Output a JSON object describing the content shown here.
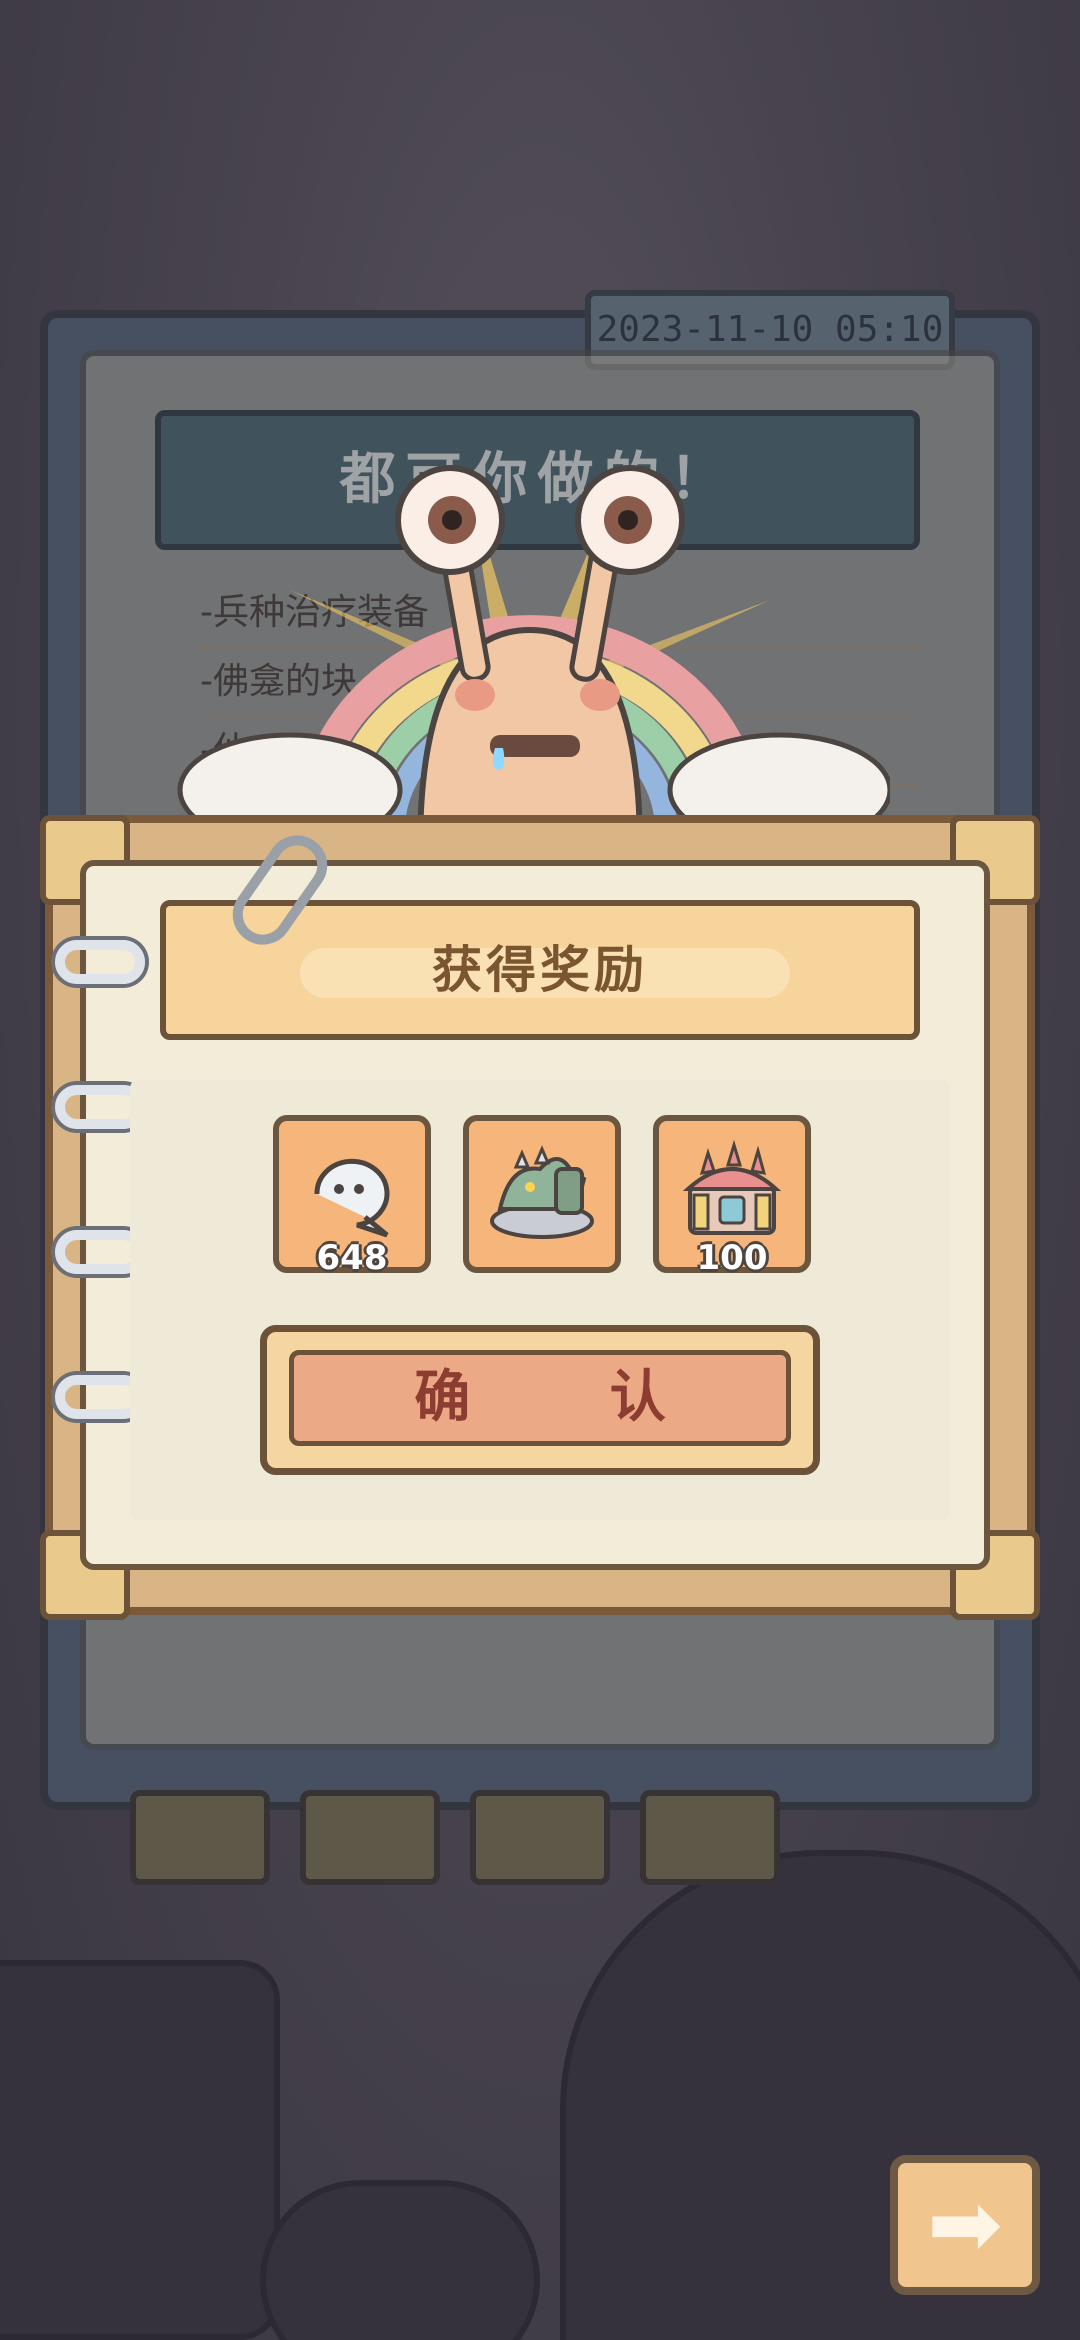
{
  "background": {
    "date_stamp": "2023-11-10 05:10",
    "header_text": "都可你做的！",
    "list_lines": [
      "-兵种治疗装备",
      "-佛龛的块",
      "-伙"
    ]
  },
  "dialog": {
    "title": "获得奖励",
    "rewards": [
      {
        "icon": "ghost-bubble-icon",
        "count": "648"
      },
      {
        "icon": "dragon-tank-icon",
        "count": ""
      },
      {
        "icon": "treasure-chest-icon",
        "count": "100"
      }
    ],
    "confirm_label": "确  认"
  },
  "colors": {
    "paper": "#f3ecd9",
    "frame": "#d9b585",
    "item_bg": "#f6b57a",
    "button": "#eba985",
    "title_text": "#7a5530"
  },
  "next_button": {
    "icon": "arrow-right-icon",
    "glyph": "➡"
  }
}
